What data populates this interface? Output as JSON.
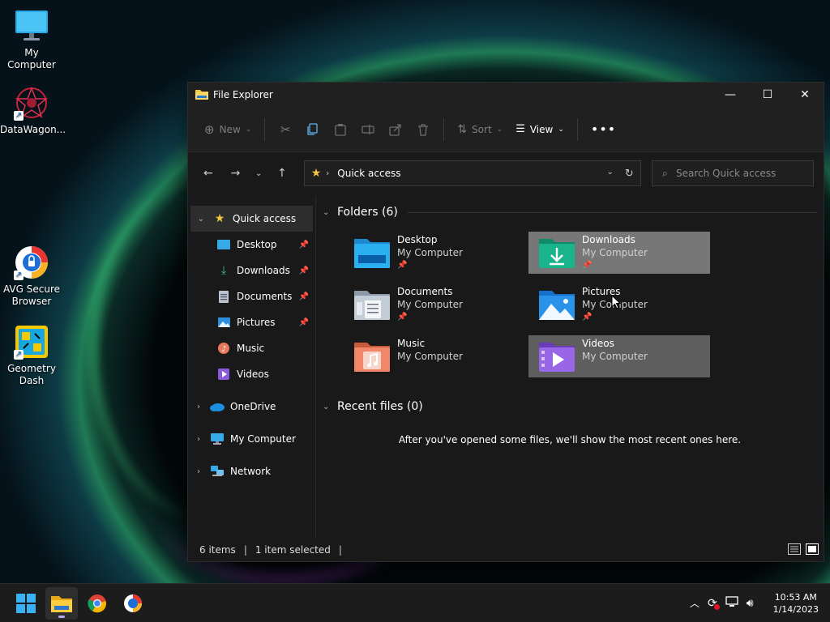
{
  "desktop": {
    "icons": [
      {
        "label": "My Computer"
      },
      {
        "label": "DataWagon..."
      },
      {
        "label": "AVG Secure Browser"
      },
      {
        "label": "Geometry Dash"
      }
    ]
  },
  "window": {
    "title": "File Explorer",
    "toolbar": {
      "new_label": "New",
      "sort_label": "Sort",
      "view_label": "View"
    },
    "address": {
      "crumb": "Quick access"
    },
    "search": {
      "placeholder": "Search Quick access"
    },
    "sidebar": {
      "items": [
        {
          "label": "Quick access"
        },
        {
          "label": "Desktop"
        },
        {
          "label": "Downloads"
        },
        {
          "label": "Documents"
        },
        {
          "label": "Pictures"
        },
        {
          "label": "Music"
        },
        {
          "label": "Videos"
        },
        {
          "label": "OneDrive"
        },
        {
          "label": "My Computer"
        },
        {
          "label": "Network"
        }
      ]
    },
    "folders_section": {
      "heading": "Folders (6)",
      "folders": [
        {
          "name": "Desktop",
          "location": "My Computer"
        },
        {
          "name": "Downloads",
          "location": "My Computer"
        },
        {
          "name": "Documents",
          "location": "My Computer"
        },
        {
          "name": "Pictures",
          "location": "My Computer"
        },
        {
          "name": "Music",
          "location": "My Computer"
        },
        {
          "name": "Videos",
          "location": "My Computer"
        }
      ]
    },
    "recent_section": {
      "heading": "Recent files (0)",
      "empty_message": "After you've opened some files, we'll show the most recent ones here."
    },
    "status": {
      "item_count": "6 items",
      "selection": "1 item selected"
    }
  },
  "taskbar": {
    "clock": {
      "time": "10:53 AM",
      "date": "1/14/2023"
    }
  },
  "colors": {
    "accent": "#0078d4",
    "selected_tile": "#777777",
    "window_bg": "#191919"
  }
}
